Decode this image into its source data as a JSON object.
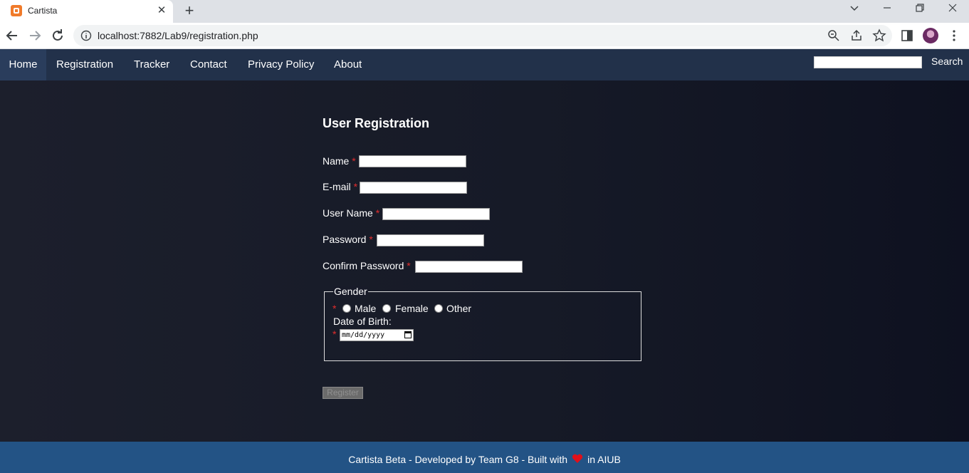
{
  "browser": {
    "tab_title": "Cartista",
    "url": "localhost:7882/Lab9/registration.php"
  },
  "nav": {
    "items": [
      {
        "label": "Home"
      },
      {
        "label": "Registration"
      },
      {
        "label": "Tracker"
      },
      {
        "label": "Contact"
      },
      {
        "label": "Privacy Policy"
      },
      {
        "label": "About"
      }
    ],
    "search_label": "Search",
    "search_value": ""
  },
  "form": {
    "title": "User Registration",
    "required_mark": "*",
    "fields": {
      "name": {
        "label": "Name",
        "value": ""
      },
      "email": {
        "label": "E-mail",
        "value": ""
      },
      "username": {
        "label": "User Name",
        "value": ""
      },
      "password": {
        "label": "Password",
        "value": ""
      },
      "confirm_password": {
        "label": "Confirm Password",
        "value": ""
      }
    },
    "gender": {
      "legend": "Gender",
      "options": [
        "Male",
        "Female",
        "Other"
      ]
    },
    "dob": {
      "label": "Date of Birth:",
      "placeholder": "mm/dd/yyyy"
    },
    "submit_label": "Register"
  },
  "footer": {
    "text_before": "Cartista Beta - Developed by Team G8 - Built with",
    "text_after": "in AIUB"
  },
  "colors": {
    "nav_bg": "#22314a",
    "page_bg": "#161a27",
    "footer_bg": "#235385",
    "required": "#e32d2d"
  }
}
